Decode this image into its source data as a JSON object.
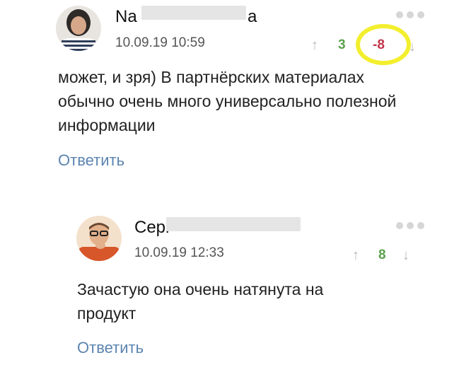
{
  "comments": [
    {
      "author_visible": "Na",
      "author_tail": "a",
      "date": "10.09.19 10:59",
      "upvote_icon": "arrow-up-icon",
      "score_up": "3",
      "score_down": "-8",
      "downvote_icon": "arrow-down-icon",
      "text": "может, и зря) В партнёрских материалах обычно очень много универсально полезной информации",
      "reply_label": "Ответить"
    },
    {
      "author_visible": "Серг",
      "date": "10.09.19 12:33",
      "upvote_icon": "arrow-up-icon",
      "score": "8",
      "downvote_icon": "arrow-down-icon",
      "text": "Зачастую она очень натянута на продукт",
      "reply_label": "Ответить"
    }
  ],
  "icons": {
    "up": "↑",
    "down": "↓"
  },
  "colors": {
    "positive": "#5aa14d",
    "negative": "#c3364a",
    "link": "#5b84b1",
    "highlight": "#f3ef2e"
  }
}
